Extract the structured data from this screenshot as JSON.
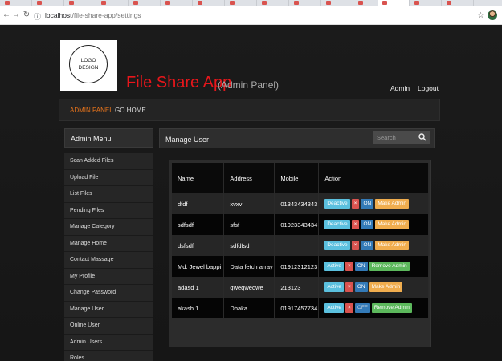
{
  "browser": {
    "url_host": "localhost",
    "url_path": "/file-share-app/settings"
  },
  "header": {
    "logo_line1": "LOGO",
    "logo_line2": "DESIGN",
    "app_title": "File Share App",
    "app_subtitle": "(Admin Panel)",
    "admin_link": "Admin",
    "logout_link": "Logout"
  },
  "nav": {
    "admin_panel": "ADMIN PANEL",
    "go_home": "GO HOME"
  },
  "sidebar": {
    "title": "Admin Menu",
    "items": [
      "Scan Added Files",
      "Upload File",
      "List Files",
      "Pending Files",
      "Manage Category",
      "Manage Home",
      "Contact Massage",
      "My Profile",
      "Change Password",
      "Manage User",
      "Online User",
      "Admin Users",
      "Roles"
    ]
  },
  "main": {
    "title": "Manage User",
    "search_placeholder": "Search",
    "columns": [
      "Name",
      "Address",
      "Mobile",
      "Action"
    ],
    "rows": [
      {
        "name": "dfdf",
        "address": "xvxv",
        "mobile": "01343434343",
        "state": "Deactive",
        "del": "×",
        "toggle": "ON",
        "admin": "Make Admin"
      },
      {
        "name": "sdfsdf",
        "address": "sfsf",
        "mobile": "01923343434",
        "state": "Deactive",
        "del": "×",
        "toggle": "ON",
        "admin": "Make Admin"
      },
      {
        "name": "dsfsdf",
        "address": "sdfdfsd",
        "mobile": "",
        "state": "Deactive",
        "del": "×",
        "toggle": "ON",
        "admin": "Make Admin"
      },
      {
        "name": "Md. Jewel bappi",
        "address": "Data fetch array",
        "mobile": "01912312123",
        "state": "Active",
        "del": "×",
        "toggle": "ON",
        "admin": "Remove Admin"
      },
      {
        "name": "adasd 1",
        "address": "qweqweqwe",
        "mobile": "213123",
        "state": "Active",
        "del": "×",
        "toggle": "ON",
        "admin": "Make Admin"
      },
      {
        "name": "akash 1",
        "address": "Dhaka",
        "mobile": "01917457734",
        "state": "Active",
        "del": "×",
        "toggle": "OFF",
        "admin": "Remove Admin"
      }
    ]
  },
  "colors": {
    "title_red": "#e8161b",
    "nav_active": "#e8741b",
    "btn_info": "#5bc0de",
    "btn_danger": "#d9534f",
    "btn_primary": "#337ab7",
    "btn_warning": "#f0ad4e",
    "btn_success": "#5cb85c"
  },
  "icons": {
    "back": "arrow-left-icon",
    "forward": "arrow-right-icon",
    "reload": "reload-icon",
    "site_info": "info-icon",
    "bookmark": "star-icon",
    "search": "search-icon"
  }
}
